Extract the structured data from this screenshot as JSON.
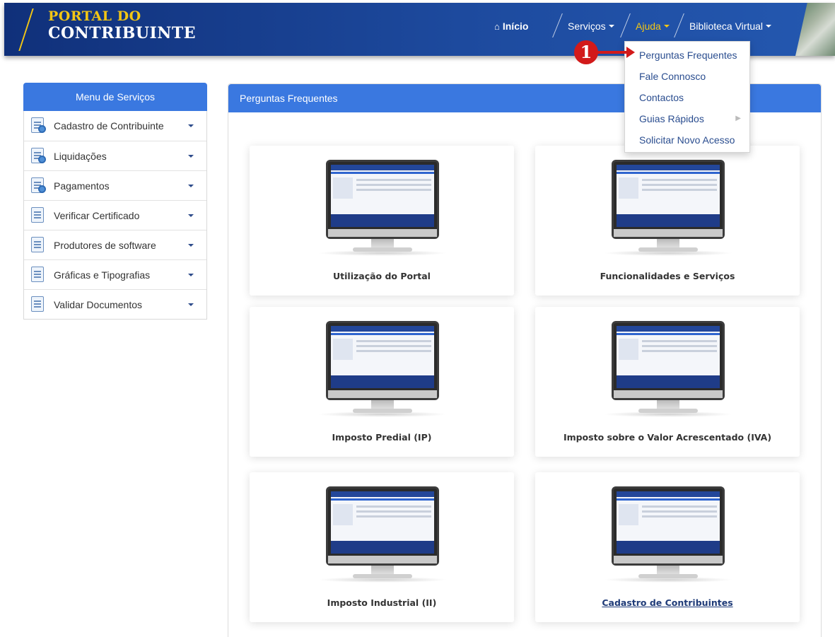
{
  "header": {
    "logo_line1": "PORTAL DO",
    "logo_line2": "CONTRIBUINTE",
    "nav": {
      "home": "Início",
      "servicos": "Serviços",
      "ajuda": "Ajuda",
      "biblioteca": "Biblioteca Virtual"
    }
  },
  "dropdown": {
    "items": [
      {
        "label": "Perguntas Frequentes"
      },
      {
        "label": "Fale Connosco"
      },
      {
        "label": "Contactos"
      },
      {
        "label": "Guias Rápidos"
      },
      {
        "label": "Solicitar Novo Acesso"
      }
    ],
    "annotation_number": "1"
  },
  "sidebar": {
    "title": "Menu de Serviços",
    "items": [
      {
        "label": "Cadastro de Contribuinte"
      },
      {
        "label": "Liquidações"
      },
      {
        "label": "Pagamentos"
      },
      {
        "label": "Verificar Certificado"
      },
      {
        "label": "Produtores de software"
      },
      {
        "label": "Gráficas e Tipografias"
      },
      {
        "label": "Validar Documentos"
      }
    ]
  },
  "main": {
    "title": "Perguntas Frequentes",
    "cards": [
      {
        "label": "Utilização do Portal"
      },
      {
        "label": "Funcionalidades e Serviços"
      },
      {
        "label": "Imposto Predial (IP)"
      },
      {
        "label": "Imposto sobre o Valor Acrescentado (IVA)"
      },
      {
        "label": "Imposto Industrial (II)"
      },
      {
        "label": "Cadastro de Contribuintes"
      }
    ]
  },
  "colors": {
    "header_blue": "#1d4a9e",
    "accent_yellow": "#f3c614",
    "panel_blue": "#3a78e0",
    "annotation_red": "#d21a1a",
    "link_blue": "#1f3b78"
  }
}
